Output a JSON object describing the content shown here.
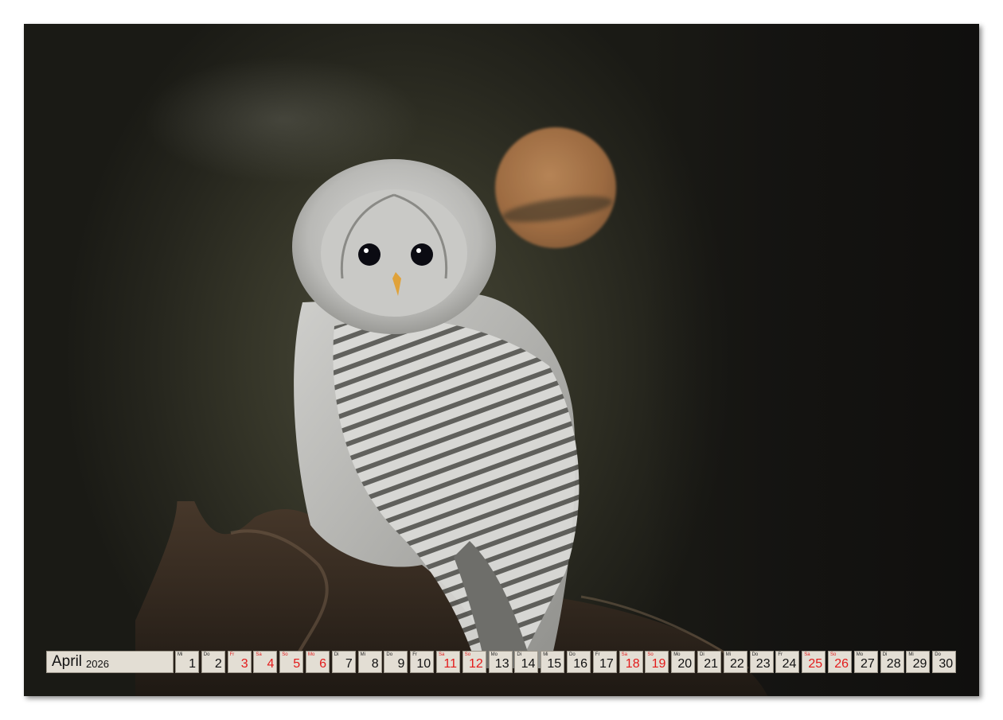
{
  "photo": {
    "subject": "owl-photo"
  },
  "calendar": {
    "month": "April",
    "year": "2026",
    "colors": {
      "cell_bg": "#e3ded4",
      "cell_border": "#9d978b",
      "holiday": "#e31a1a",
      "normal": "#111111"
    },
    "days": [
      {
        "dow": "Mi",
        "num": "1",
        "red": false
      },
      {
        "dow": "Do",
        "num": "2",
        "red": false
      },
      {
        "dow": "Fr",
        "num": "3",
        "red": true
      },
      {
        "dow": "Sa",
        "num": "4",
        "red": true
      },
      {
        "dow": "So",
        "num": "5",
        "red": true
      },
      {
        "dow": "Mo",
        "num": "6",
        "red": true
      },
      {
        "dow": "Di",
        "num": "7",
        "red": false
      },
      {
        "dow": "Mi",
        "num": "8",
        "red": false
      },
      {
        "dow": "Do",
        "num": "9",
        "red": false
      },
      {
        "dow": "Fr",
        "num": "10",
        "red": false
      },
      {
        "dow": "Sa",
        "num": "11",
        "red": true
      },
      {
        "dow": "So",
        "num": "12",
        "red": true
      },
      {
        "dow": "Mo",
        "num": "13",
        "red": false
      },
      {
        "dow": "Di",
        "num": "14",
        "red": false
      },
      {
        "dow": "Mi",
        "num": "15",
        "red": false
      },
      {
        "dow": "Do",
        "num": "16",
        "red": false
      },
      {
        "dow": "Fr",
        "num": "17",
        "red": false
      },
      {
        "dow": "Sa",
        "num": "18",
        "red": true
      },
      {
        "dow": "So",
        "num": "19",
        "red": true
      },
      {
        "dow": "Mo",
        "num": "20",
        "red": false
      },
      {
        "dow": "Di",
        "num": "21",
        "red": false
      },
      {
        "dow": "Mi",
        "num": "22",
        "red": false
      },
      {
        "dow": "Do",
        "num": "23",
        "red": false
      },
      {
        "dow": "Fr",
        "num": "24",
        "red": false
      },
      {
        "dow": "Sa",
        "num": "25",
        "red": true
      },
      {
        "dow": "So",
        "num": "26",
        "red": true
      },
      {
        "dow": "Mo",
        "num": "27",
        "red": false
      },
      {
        "dow": "Di",
        "num": "28",
        "red": false
      },
      {
        "dow": "Mi",
        "num": "29",
        "red": false
      },
      {
        "dow": "Do",
        "num": "30",
        "red": false
      }
    ]
  }
}
